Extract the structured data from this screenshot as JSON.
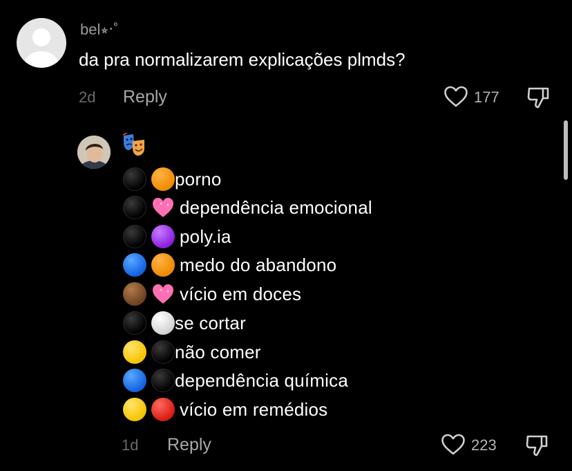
{
  "top_comment": {
    "username": "bel⭒‧˚",
    "text": "da pra normalizarem explicações plmds?",
    "time": "2d",
    "reply_label": "Reply",
    "like_count": "177",
    "avatar_icon": "default-avatar-icon"
  },
  "reply_comment": {
    "header_emoji": "performing-arts-masks",
    "time": "1d",
    "reply_label": "Reply",
    "like_count": "223",
    "items": [
      {
        "emoji": [
          "black-circle",
          "orange-circle"
        ],
        "label": "porno"
      },
      {
        "emoji": [
          "black-circle",
          "pink-heart"
        ],
        "label": "dependência emocional"
      },
      {
        "emoji": [
          "black-circle",
          "purple-circle"
        ],
        "label": "poly.ia"
      },
      {
        "emoji": [
          "blue-circle",
          "orange-circle"
        ],
        "label": "medo do abandono"
      },
      {
        "emoji": [
          "brown-circle",
          "pink-heart"
        ],
        "label": "vício em doces"
      },
      {
        "emoji": [
          "black-circle",
          "white-circle"
        ],
        "label": "se cortar"
      },
      {
        "emoji": [
          "yellow-circle",
          "black-circle"
        ],
        "label": "não comer"
      },
      {
        "emoji": [
          "blue-circle",
          "black-circle"
        ],
        "label": "dependência química"
      },
      {
        "emoji": [
          "yellow-circle",
          "red-circle"
        ],
        "label": "vício em remédios"
      }
    ]
  },
  "icons": {
    "like": "heart-outline-icon",
    "dislike": "thumbs-down-icon"
  },
  "colors": {
    "background": "#000000",
    "text": "#ffffff",
    "muted": "#a8a8a8"
  }
}
